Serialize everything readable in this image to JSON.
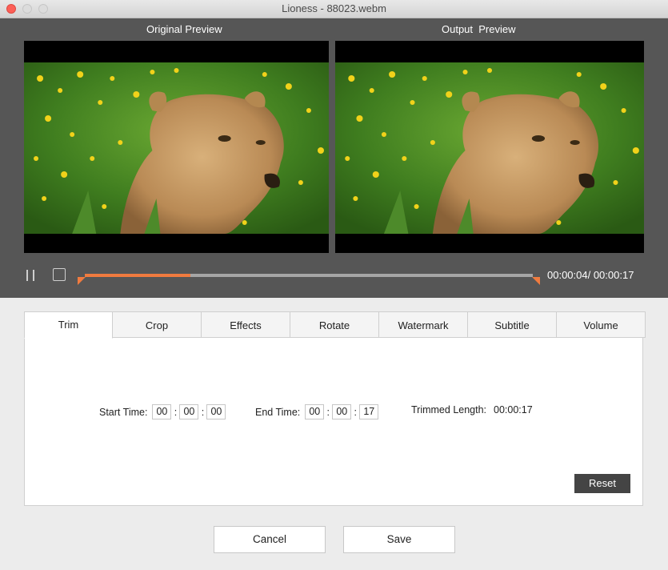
{
  "window": {
    "title": "Lioness - 88023.webm"
  },
  "preview": {
    "original_label": "Original Preview",
    "output_label": "Output  Preview"
  },
  "playback": {
    "current_time": "00:00:04",
    "total_time": "00:00:17",
    "time_display": "00:00:04/ 00:00:17",
    "progress_fraction": 0.235,
    "accent_color": "#f07b3f"
  },
  "tabs": [
    {
      "label": "Trim",
      "active": true
    },
    {
      "label": "Crop",
      "active": false
    },
    {
      "label": "Effects",
      "active": false
    },
    {
      "label": "Rotate",
      "active": false
    },
    {
      "label": "Watermark",
      "active": false
    },
    {
      "label": "Subtitle",
      "active": false
    },
    {
      "label": "Volume",
      "active": false
    }
  ],
  "trim": {
    "start_label": "Start Time:",
    "start": [
      "00",
      "00",
      "00"
    ],
    "end_label": "End Time:",
    "end": [
      "00",
      "00",
      "17"
    ],
    "length_label": "Trimmed Length:",
    "length_value": "00:00:17",
    "reset_label": "Reset"
  },
  "footer": {
    "cancel_label": "Cancel",
    "save_label": "Save"
  },
  "icons": {
    "pause": "pause-icon",
    "stop": "stop-icon"
  }
}
